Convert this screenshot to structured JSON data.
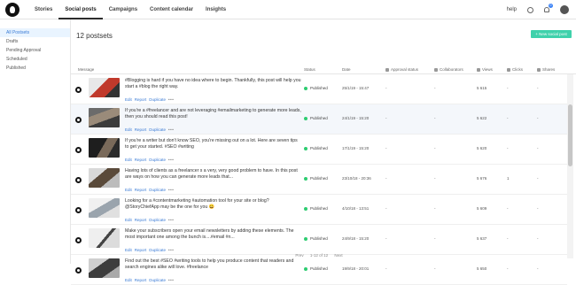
{
  "nav": {
    "items": [
      {
        "label": "Stories",
        "active": false
      },
      {
        "label": "Social posts",
        "active": true
      },
      {
        "label": "Campaigns",
        "active": false
      },
      {
        "label": "Content calendar",
        "active": false
      },
      {
        "label": "Insights",
        "active": false
      }
    ],
    "help_label": "help",
    "notification_count": "0"
  },
  "sidebar": {
    "items": [
      {
        "label": "All Postsets",
        "active": true
      },
      {
        "label": "Drafts",
        "active": false
      },
      {
        "label": "Pending Approval",
        "active": false
      },
      {
        "label": "Scheduled",
        "active": false
      },
      {
        "label": "Published",
        "active": false
      }
    ]
  },
  "main": {
    "title": "12 postsets",
    "new_button": "+ New social post"
  },
  "table": {
    "headers": {
      "message": "Message",
      "status": "Status",
      "date": "Date",
      "approval": "Approval status",
      "collaborators": "Collaborators",
      "views": "Views",
      "clicks": "Clicks",
      "shares": "Shares"
    },
    "actions": {
      "edit": "Edit",
      "report": "Report",
      "duplicate": "Duplicate",
      "more": "•••"
    },
    "rows": [
      {
        "message": "#Blogging is hard if you have no idea where to begin. Thankfully, this post will help you start a #blog the right way.",
        "status": "Published",
        "date": "25/1/19 - 15:47",
        "approval": "-",
        "collaborators": "-",
        "views": "5 615",
        "clicks": "-",
        "shares": "-",
        "thumb": "laptop-red"
      },
      {
        "message": "If you're a #freelancer and are not leveraging #emailmarketing to generate more leads, then you should read this post!",
        "status": "Published",
        "date": "24/1/19 - 15:20",
        "approval": "-",
        "collaborators": "-",
        "views": "5 622",
        "clicks": "-",
        "shares": "-",
        "thumb": "desk-people"
      },
      {
        "message": "If you're a writer but don't know SEO, you're missing out on a lot. Here are seven tips to get your started. #SEO #writing",
        "status": "Published",
        "date": "17/1/19 - 15:20",
        "approval": "-",
        "collaborators": "-",
        "views": "5 620",
        "clicks": "-",
        "shares": "-",
        "thumb": "typing-dark"
      },
      {
        "message": "Having lots of clients as a freelancer s a very, very good problem to have. In this post are ways on how you can generate more leads that...",
        "status": "Published",
        "date": "23/10/18 - 20:36",
        "approval": "-",
        "collaborators": "-",
        "views": "5 676",
        "clicks": "1",
        "shares": "-",
        "thumb": "hands-desk"
      },
      {
        "message": "Looking for a #contentmarketing #automation tool for your site or blog? @StoryChiefApp may be the one for you 😀",
        "status": "Published",
        "date": "4/10/18 - 13:51",
        "approval": "-",
        "collaborators": "-",
        "views": "5 609",
        "clicks": "-",
        "shares": "-",
        "thumb": "laptop-light"
      },
      {
        "message": "Make your subscribers open your email newsletters by adding these elements. The most important one among the bunch is....#email #n...",
        "status": "Published",
        "date": "24/9/18 - 15:20",
        "approval": "-",
        "collaborators": "-",
        "views": "5 637",
        "clicks": "-",
        "shares": "-",
        "thumb": "notebook"
      },
      {
        "message": "Find out the best #SEO #writing tools to help you produce content that readers and search engines alike will love. #freelance",
        "status": "Published",
        "date": "19/9/18 - 20:01",
        "approval": "-",
        "collaborators": "-",
        "views": "5 650",
        "clicks": "-",
        "shares": "-",
        "thumb": "laptop-hands"
      }
    ]
  },
  "pager": {
    "prev": "Prev",
    "range": "1-12 of 12",
    "next": "Next"
  },
  "colors": {
    "accent": "#3fd1ab",
    "link": "#3a7bd5",
    "published_dot": "#2ecc71"
  }
}
